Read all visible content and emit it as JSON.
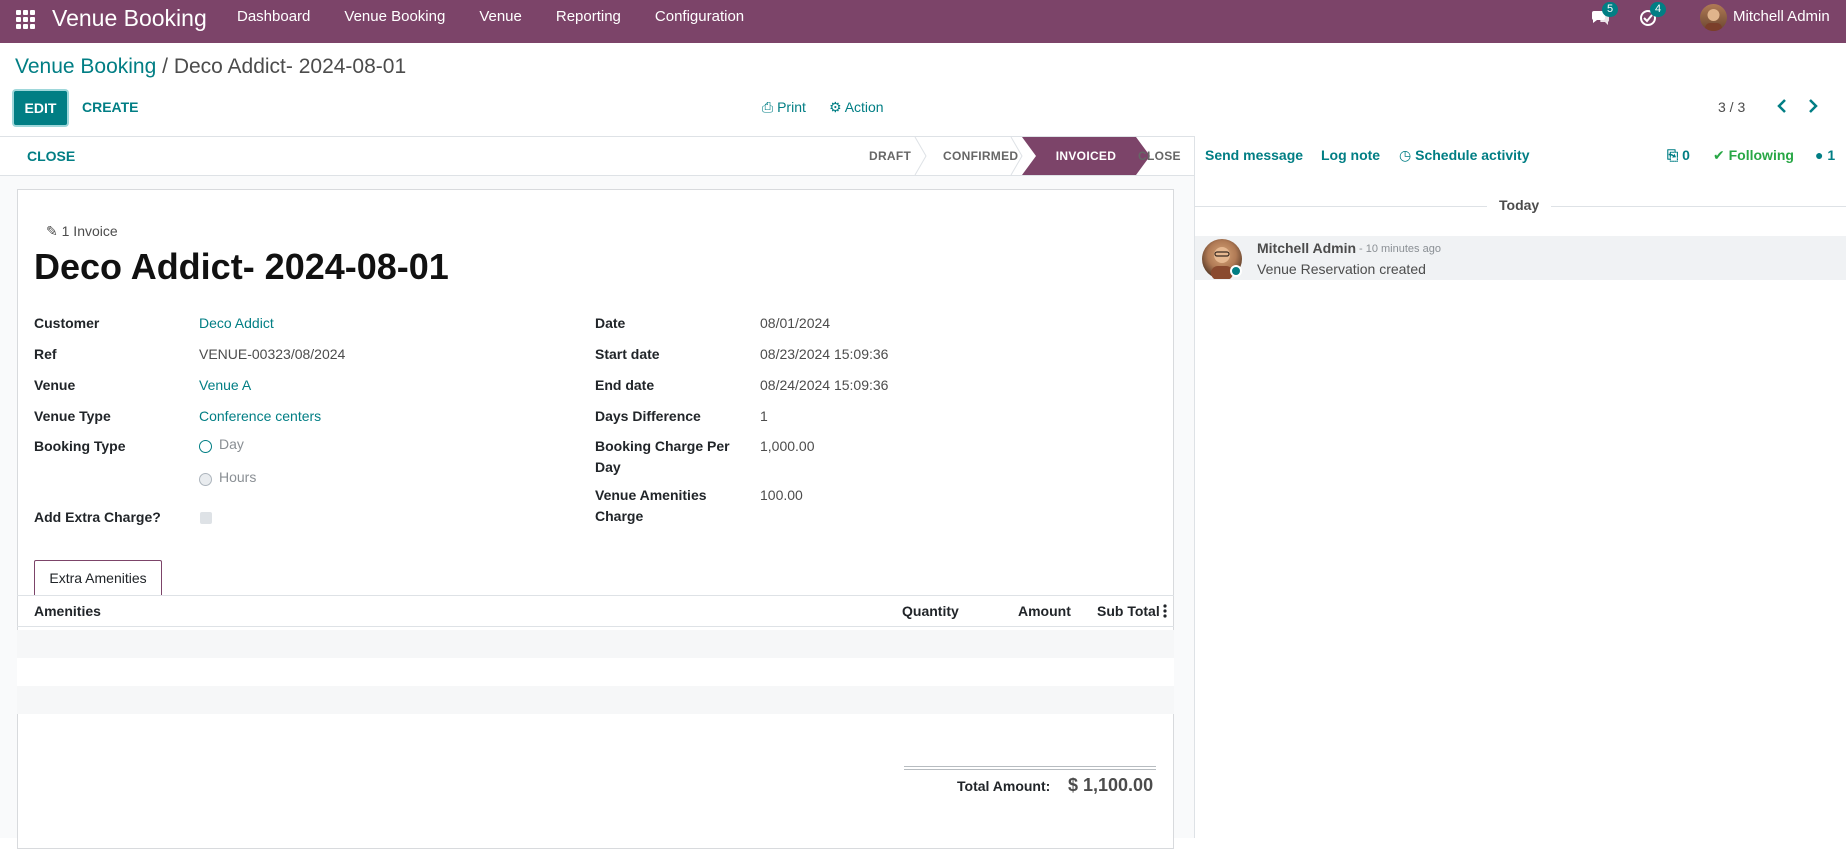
{
  "navbar": {
    "app_name": "Venue Booking",
    "menu": [
      "Dashboard",
      "Venue Booking",
      "Venue",
      "Reporting",
      "Configuration"
    ],
    "messages_count": "5",
    "activities_count": "4",
    "user_name": "Mitchell Admin",
    "color": "#7c4469"
  },
  "breadcrumb": {
    "parent": "Venue Booking",
    "separator": " / ",
    "current": "Deco Addict- 2024-08-01"
  },
  "control": {
    "edit_label": "EDIT",
    "create_label": "CREATE",
    "print_label": "Print",
    "action_label": "Action",
    "pager": "3 / 3"
  },
  "statusbar": {
    "close_label": "CLOSE",
    "stages": [
      "DRAFT",
      "CONFIRMED",
      "INVOICED",
      "CLOSE"
    ],
    "active_stage": "INVOICED"
  },
  "form": {
    "smart_button": "1 Invoice",
    "title": "Deco Addict- 2024-08-01",
    "left": {
      "customer_label": "Customer",
      "customer": "Deco Addict",
      "ref_label": "Ref",
      "ref": "VENUE-00323/08/2024",
      "venue_label": "Venue",
      "venue": "Venue A",
      "venue_type_label": "Venue Type",
      "venue_type": "Conference centers",
      "booking_type_label": "Booking Type",
      "booking_type_options": [
        "Day",
        "Hours"
      ],
      "booking_type_selected": "Day",
      "extra_charge_label": "Add Extra Charge?"
    },
    "right": {
      "date_label": "Date",
      "date": "08/01/2024",
      "start_label": "Start date",
      "start": "08/23/2024 15:09:36",
      "end_label": "End date",
      "end": "08/24/2024 15:09:36",
      "days_label": "Days Difference",
      "days": "1",
      "charge_label_1": "Booking Charge Per",
      "charge_label_2": "Day",
      "charge": "1,000.00",
      "amenities_label_1": "Venue Amenities",
      "amenities_label_2": "Charge",
      "amenities_charge": "100.00"
    },
    "tab_label": "Extra Amenities",
    "table_headers": [
      "Amenities",
      "Quantity",
      "Amount",
      "Sub Total"
    ],
    "total_label": "Total Amount:",
    "total_value": "$ 1,100.00"
  },
  "chatter": {
    "send_message": "Send message",
    "log_note": "Log note",
    "schedule_activity": "Schedule activity",
    "attachments": "0",
    "following": "Following",
    "followers": "1",
    "day": "Today",
    "message": {
      "author": "Mitchell Admin",
      "date": "- 10 minutes ago",
      "body": "Venue Reservation created"
    }
  }
}
